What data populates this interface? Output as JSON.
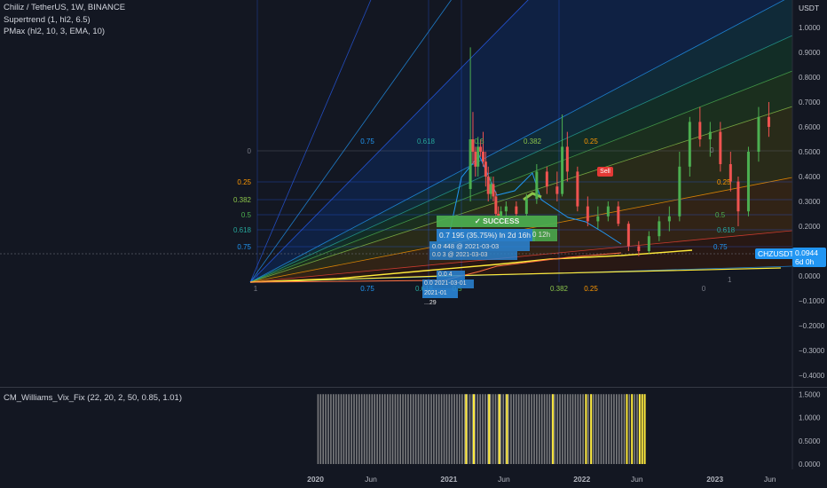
{
  "header": {
    "symbol_line": "Chiliz / TetherUS, 1W, BINANCE",
    "indicator_1": "Supertrend (1, hl2, 6.5)",
    "indicator_2": "PMax (hl2, 10, 3, EMA, 10)",
    "sub_indicator": "CM_Williams_Vix_Fix (22, 20, 2, 50, 0.85, 1.01)"
  },
  "colors": {
    "background": "#131722",
    "up": "#4caf50",
    "down": "#ef5350",
    "accent_blue": "#2196f3",
    "accent_yellow": "#ffeb3b",
    "success_green": "#4caf50",
    "sell_red": "#e53935"
  },
  "price_axis": {
    "unit": "USDT",
    "ticks": [
      "1.0000",
      "0.9000",
      "0.8000",
      "0.7000",
      "0.6000",
      "0.5000",
      "0.4000",
      "0.3000",
      "0.2000",
      "0.1000",
      "0.0000",
      "−0.1000",
      "−0.2000",
      "−0.3000",
      "−0.4000"
    ],
    "current_symbol": "CHZUSDT",
    "current_price": "0.0944",
    "countdown": "6d 0h"
  },
  "sub_axis": {
    "ticks": [
      "1.5000",
      "1.0000",
      "0.5000",
      "0.0000"
    ]
  },
  "time_axis": {
    "labels": [
      "2020",
      "Jun",
      "2021",
      "Jun",
      "2022",
      "Jun",
      "2023",
      "Jun"
    ]
  },
  "fib_labels": {
    "left_level": [
      "0",
      "0.25",
      "0.382",
      "0.5",
      "0.618",
      "0.75"
    ],
    "bottom": [
      "1",
      "0.75",
      "0.618",
      "0.5",
      "0.382",
      "0.25"
    ],
    "top": [
      "0.75",
      "0.618",
      "0.5",
      "0.382",
      "0.25"
    ],
    "right": [
      "0",
      "0.25",
      "0.5",
      "0.618",
      "0.75",
      "1"
    ]
  },
  "annotations": {
    "success": "✓ SUCCESS",
    "target": "0.7 195 (35.75%) In 2d 16h",
    "target_tail": "0 12h",
    "entry": "0.0 448 @ 2021-03-03",
    "entry_2": "0.0 3 @ 2021-03-03",
    "stop": "0.0 4",
    "date_1": "0.0 2021-03-01",
    "date_2": "2021-01 ...29",
    "sell": "Sell"
  },
  "chart_data": {
    "type": "candlestick",
    "symbol": "CHZUSDT",
    "interval": "1W",
    "ylim": [
      -0.45,
      1.05
    ],
    "x_range": [
      "2019-07",
      "2023-07"
    ],
    "candles": [
      [
        "2021-03-01",
        0.35,
        0.92,
        0.3,
        0.55
      ],
      [
        "2021-03-08",
        0.55,
        0.66,
        0.45,
        0.5
      ],
      [
        "2021-03-15",
        0.5,
        0.52,
        0.4,
        0.44
      ],
      [
        "2021-03-22",
        0.44,
        0.56,
        0.4,
        0.52
      ],
      [
        "2021-03-29",
        0.52,
        0.55,
        0.48,
        0.5
      ],
      [
        "2021-04-05",
        0.5,
        0.58,
        0.44,
        0.46
      ],
      [
        "2021-04-12",
        0.46,
        0.5,
        0.36,
        0.4
      ],
      [
        "2021-04-19",
        0.4,
        0.44,
        0.3,
        0.33
      ],
      [
        "2021-04-26",
        0.33,
        0.4,
        0.31,
        0.37
      ],
      [
        "2021-05-03",
        0.37,
        0.4,
        0.3,
        0.32
      ],
      [
        "2021-05-10",
        0.32,
        0.34,
        0.22,
        0.25
      ],
      [
        "2021-05-17",
        0.25,
        0.28,
        0.2,
        0.24
      ],
      [
        "2021-05-24",
        0.24,
        0.28,
        0.21,
        0.26
      ],
      [
        "2021-06-07",
        0.26,
        0.3,
        0.23,
        0.28
      ],
      [
        "2021-07-05",
        0.28,
        0.3,
        0.24,
        0.25
      ],
      [
        "2021-08-02",
        0.25,
        0.33,
        0.24,
        0.31
      ],
      [
        "2021-08-30",
        0.31,
        0.45,
        0.29,
        0.42
      ],
      [
        "2021-09-27",
        0.42,
        0.44,
        0.33,
        0.36
      ],
      [
        "2021-10-25",
        0.36,
        0.42,
        0.3,
        0.33
      ],
      [
        "2021-11-08",
        0.33,
        0.65,
        0.32,
        0.52
      ],
      [
        "2021-11-22",
        0.52,
        0.58,
        0.38,
        0.42
      ],
      [
        "2021-12-20",
        0.42,
        0.44,
        0.26,
        0.28
      ],
      [
        "2022-01-17",
        0.28,
        0.32,
        0.2,
        0.22
      ],
      [
        "2022-02-14",
        0.22,
        0.28,
        0.19,
        0.24
      ],
      [
        "2022-03-14",
        0.24,
        0.3,
        0.22,
        0.28
      ],
      [
        "2022-04-11",
        0.28,
        0.3,
        0.2,
        0.21
      ],
      [
        "2022-05-09",
        0.21,
        0.22,
        0.1,
        0.12
      ],
      [
        "2022-06-06",
        0.12,
        0.14,
        0.08,
        0.1
      ],
      [
        "2022-07-04",
        0.1,
        0.18,
        0.09,
        0.16
      ],
      [
        "2022-08-01",
        0.16,
        0.24,
        0.14,
        0.22
      ],
      [
        "2022-08-29",
        0.22,
        0.28,
        0.18,
        0.24
      ],
      [
        "2022-09-26",
        0.24,
        0.5,
        0.22,
        0.44
      ],
      [
        "2022-10-24",
        0.44,
        0.64,
        0.4,
        0.62
      ],
      [
        "2022-11-21",
        0.62,
        0.68,
        0.52,
        0.55
      ],
      [
        "2022-12-19",
        0.55,
        0.62,
        0.48,
        0.58
      ],
      [
        "2023-01-16",
        0.58,
        0.62,
        0.42,
        0.45
      ],
      [
        "2023-02-13",
        0.45,
        0.5,
        0.34,
        0.38
      ],
      [
        "2023-03-06",
        0.38,
        0.4,
        0.2,
        0.26
      ],
      [
        "2023-04-03",
        0.26,
        0.52,
        0.24,
        0.5
      ],
      [
        "2023-05-01",
        0.5,
        0.68,
        0.46,
        0.64
      ],
      [
        "2023-05-29",
        0.64,
        0.7,
        0.56,
        0.6
      ]
    ],
    "vix_fix": {
      "ylim": [
        0,
        1.6
      ],
      "yellow_bar_dates": [
        "2021-02-15",
        "2021-03-08",
        "2021-04-19",
        "2021-05-17",
        "2021-06-07",
        "2021-10-11",
        "2022-01-10",
        "2022-01-24",
        "2022-05-02",
        "2022-05-16",
        "2022-06-06",
        "2022-06-13",
        "2022-06-20"
      ],
      "gray_range": [
        "2020-01",
        "2022-06"
      ]
    }
  }
}
